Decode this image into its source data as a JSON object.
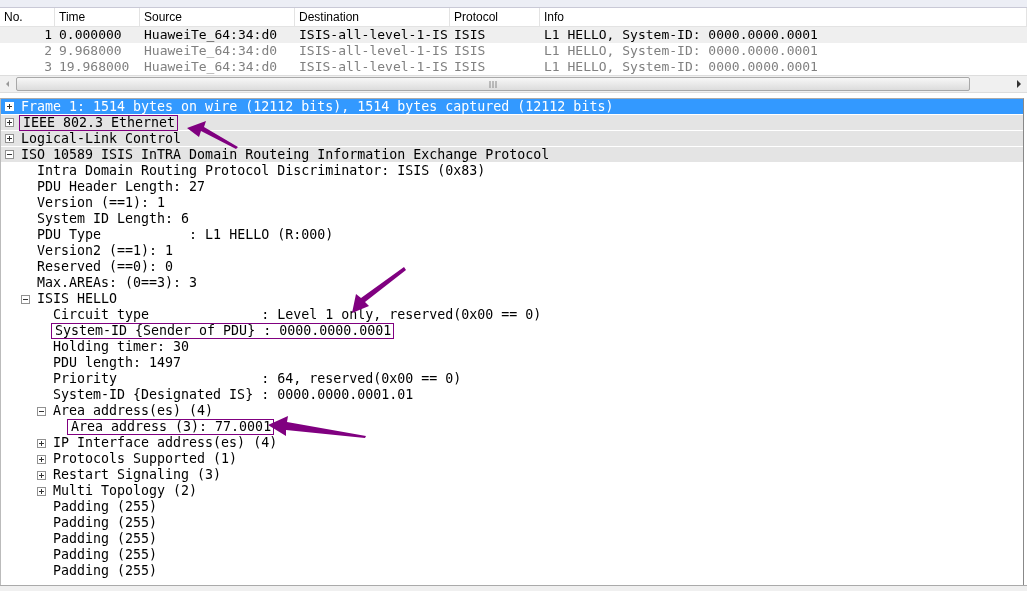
{
  "packet_list": {
    "columns": [
      "No.",
      "Time",
      "Source",
      "Destination",
      "Protocol",
      "Info"
    ],
    "rows": [
      {
        "cells": [
          "1",
          "0.000000",
          "HuaweiTe_64:34:d0",
          "ISIS-all-level-1-IS",
          "ISIS",
          "L1 HELLO, System-ID: 0000.0000.0001"
        ],
        "selected": true
      },
      {
        "cells": [
          "2",
          "9.968000",
          "HuaweiTe_64:34:d0",
          "ISIS-all-level-1-IS",
          "ISIS",
          "L1 HELLO, System-ID: 0000.0000.0001"
        ],
        "selected": false
      },
      {
        "cells": [
          "3",
          "19.968000",
          "HuaweiTe_64:34:d0",
          "ISIS-all-level-1-IS",
          "ISIS",
          "L1 HELLO, System-ID: 0000.0000.0001"
        ],
        "selected": false
      }
    ]
  },
  "packet_details": [
    {
      "label": "Frame 1: 1514 bytes on wire (12112 bits), 1514 bytes captured (12112 bits)",
      "expanded": false,
      "selected": true,
      "boxed": false
    },
    {
      "label": "IEEE 802.3 Ethernet",
      "expanded": false,
      "selected": false,
      "boxed": true
    },
    {
      "label": "Logical-Link Control",
      "expanded": false,
      "selected": false,
      "boxed": false
    },
    {
      "label": "ISO 10589 ISIS InTRA Domain Routeing Information Exchange Protocol",
      "expanded": true,
      "selected": false,
      "boxed": false,
      "children": [
        {
          "label": "Intra Domain Routing Protocol Discriminator: ISIS (0x83)",
          "selected": false,
          "boxed": false
        },
        {
          "label": "PDU Header Length: 27",
          "selected": false,
          "boxed": false
        },
        {
          "label": "Version (==1): 1",
          "selected": false,
          "boxed": false
        },
        {
          "label": "System ID Length: 6",
          "selected": false,
          "boxed": false
        },
        {
          "label": "PDU Type           : L1 HELLO (R:000)",
          "selected": false,
          "boxed": false
        },
        {
          "label": "Version2 (==1): 1",
          "selected": false,
          "boxed": false
        },
        {
          "label": "Reserved (==0): 0",
          "selected": false,
          "boxed": false
        },
        {
          "label": "Max.AREAs: (0==3): 3",
          "selected": false,
          "boxed": false
        },
        {
          "label": "ISIS HELLO",
          "expanded": true,
          "selected": false,
          "boxed": false,
          "children": [
            {
              "label": "Circuit type              : Level 1 only, reserved(0x00 == 0)",
              "selected": false,
              "boxed": false
            },
            {
              "label": "System-ID {Sender of PDU} : 0000.0000.0001",
              "selected": false,
              "boxed": true
            },
            {
              "label": "Holding timer: 30",
              "selected": false,
              "boxed": false
            },
            {
              "label": "PDU length: 1497",
              "selected": false,
              "boxed": false
            },
            {
              "label": "Priority                  : 64, reserved(0x00 == 0)",
              "selected": false,
              "boxed": false
            },
            {
              "label": "System-ID {Designated IS} : 0000.0000.0001.01",
              "selected": false,
              "boxed": false
            },
            {
              "label": "Area address(es) (4)",
              "expanded": true,
              "selected": false,
              "boxed": false,
              "children": [
                {
                  "label": "Area address (3): 77.0001",
                  "selected": false,
                  "boxed": true
                }
              ]
            },
            {
              "label": "IP Interface address(es) (4)",
              "expanded": false,
              "selected": false,
              "boxed": false
            },
            {
              "label": "Protocols Supported (1)",
              "expanded": false,
              "selected": false,
              "boxed": false
            },
            {
              "label": "Restart Signaling (3)",
              "expanded": false,
              "selected": false,
              "boxed": false
            },
            {
              "label": "Multi Topology (2)",
              "expanded": false,
              "selected": false,
              "boxed": false
            },
            {
              "label": "Padding (255)",
              "selected": false,
              "boxed": false
            },
            {
              "label": "Padding (255)",
              "selected": false,
              "boxed": false
            },
            {
              "label": "Padding (255)",
              "selected": false,
              "boxed": false
            },
            {
              "label": "Padding (255)",
              "selected": false,
              "boxed": false
            },
            {
              "label": "Padding (255)",
              "selected": false,
              "boxed": false
            }
          ]
        }
      ]
    }
  ]
}
